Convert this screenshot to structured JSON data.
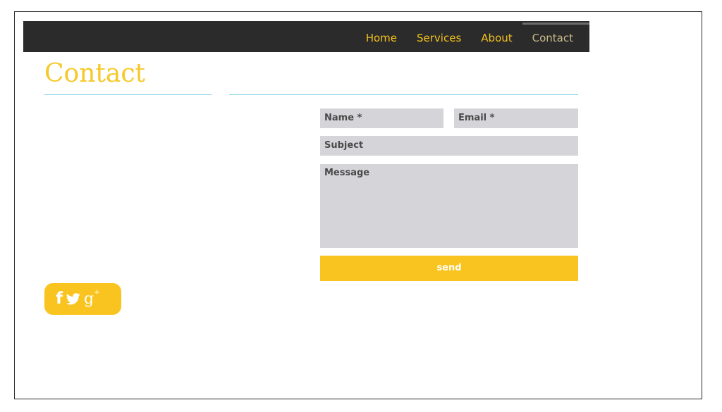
{
  "nav": {
    "items": [
      {
        "label": "Home",
        "active": false
      },
      {
        "label": "Services",
        "active": false
      },
      {
        "label": "About",
        "active": false
      },
      {
        "label": "Contact",
        "active": true
      }
    ]
  },
  "page": {
    "title": "Contact"
  },
  "form": {
    "name_placeholder": "Name *",
    "email_placeholder": "Email *",
    "subject_placeholder": "Subject",
    "message_placeholder": "Message",
    "send_label": "send"
  },
  "social": {
    "icons": [
      "facebook-icon",
      "twitter-icon",
      "google-plus-icon"
    ],
    "facebook_glyph": "f",
    "google_glyph": "g",
    "google_plus": "+"
  },
  "colors": {
    "accent": "#f9c41f",
    "navbar_bg": "#2b2b2b",
    "nav_text": "#f4c21c",
    "nav_active_text": "#c9b98a",
    "divider": "#7fd0e2",
    "field_bg": "#d5d5d9"
  }
}
